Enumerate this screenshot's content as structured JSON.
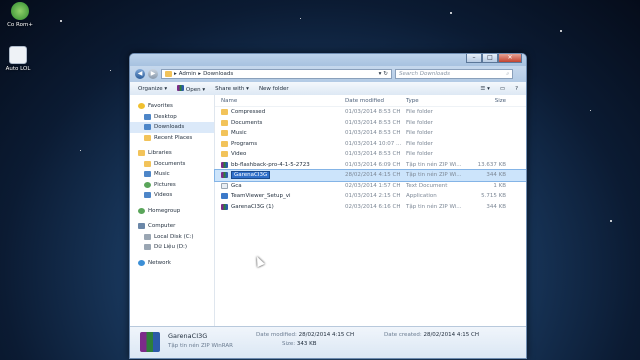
{
  "desktop": {
    "icons": [
      {
        "label": "Co Rom+",
        "icon": "app-icon"
      },
      {
        "label": "Auto LOL",
        "icon": "document-icon"
      }
    ]
  },
  "window": {
    "address": {
      "root": "Admin",
      "current": "Downloads"
    },
    "search_placeholder": "Search Downloads",
    "toolbar": {
      "organize": "Organize",
      "open": "Open",
      "share": "Share with",
      "new_folder": "New folder"
    },
    "nav": {
      "favorites": "Favorites",
      "desktop": "Desktop",
      "downloads": "Downloads",
      "recent": "Recent Places",
      "libraries": "Libraries",
      "documents": "Documents",
      "music": "Music",
      "pictures": "Pictures",
      "videos": "Videos",
      "homegroup": "Homegroup",
      "computer": "Computer",
      "local_disk": "Local Disk (C:)",
      "du_lieu": "Dữ Liệu (D:)",
      "network": "Network"
    },
    "columns": {
      "name": "Name",
      "date": "Date modified",
      "type": "Type",
      "size": "Size"
    },
    "files": [
      {
        "name": "Compressed",
        "date": "01/03/2014 8:53 CH",
        "type": "File folder",
        "size": "",
        "icon": "folder-icon"
      },
      {
        "name": "Documents",
        "date": "01/03/2014 8:53 CH",
        "type": "File folder",
        "size": "",
        "icon": "folder-icon"
      },
      {
        "name": "Music",
        "date": "01/03/2014 8:53 CH",
        "type": "File folder",
        "size": "",
        "icon": "folder-icon"
      },
      {
        "name": "Programs",
        "date": "01/03/2014 10:07 ...",
        "type": "File folder",
        "size": "",
        "icon": "folder-icon"
      },
      {
        "name": "Video",
        "date": "01/03/2014 8:53 CH",
        "type": "File folder",
        "size": "",
        "icon": "folder-icon"
      },
      {
        "name": "bb-flashback-pro-4-1-5-2723",
        "date": "01/03/2014 6:09 CH",
        "type": "Tập tin nén ZIP Wi...",
        "size": "13.637 KB",
        "icon": "archive-icon"
      },
      {
        "name": "GarenaCI3G",
        "date": "28/02/2014 4:15 CH",
        "type": "Tập tin nén ZIP Wi...",
        "size": "344 KB",
        "icon": "archive-icon"
      },
      {
        "name": "Gca",
        "date": "02/03/2014 1:57 CH",
        "type": "Text Document",
        "size": "1 KB",
        "icon": "text-file-icon"
      },
      {
        "name": "TeamViewer_Setup_vi",
        "date": "01/03/2014 2:15 CH",
        "type": "Application",
        "size": "5.715 KB",
        "icon": "application-icon"
      },
      {
        "name": "GarenaCI3G (1)",
        "date": "02/03/2014 6:16 CH",
        "type": "Tập tin nén ZIP Wi...",
        "size": "344 KB",
        "icon": "archive-icon"
      }
    ],
    "details": {
      "name": "GarenaCI3G",
      "type": "Tập tin nén ZIP WinRAR",
      "date_modified_label": "Date modified:",
      "date_modified": "28/02/2014 4:15 CH",
      "size_label": "Size:",
      "size": "343 KB",
      "date_created_label": "Date created:",
      "date_created": "28/02/2014 4:15 CH"
    }
  }
}
